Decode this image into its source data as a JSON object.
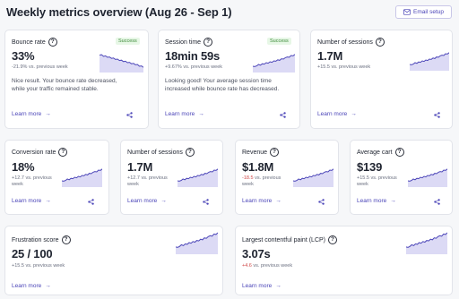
{
  "page": {
    "title": "Weekly metrics overview (Aug 26 - Sep 1)"
  },
  "actions": {
    "email_setup": "Email setup"
  },
  "common": {
    "learn_more": "Learn more",
    "help": "?",
    "arrow": "→"
  },
  "colors": {
    "accent": "#4b45b8",
    "spark_line": "#4b45b8",
    "spark_fill": "#dcdaf5",
    "success_bg": "#e7f7e6",
    "success_text": "#3d8b3a",
    "negative": "#d04a4a"
  },
  "cards": [
    {
      "title": "Bounce rate",
      "value": "33%",
      "badge": "Success",
      "delta": "-21.9%",
      "delta_suffix": " vs. previous week",
      "delta_color": "neutral",
      "description": [
        "Nice result. Your bounce rate decreased,",
        "while your traffic remained stable."
      ],
      "trend": "down"
    },
    {
      "title": "Session time",
      "value": "18min 59s",
      "badge": "Success",
      "delta": "+9.67%",
      "delta_suffix": " vs. previous week",
      "delta_color": "neutral",
      "description": [
        "Looking good! Your average session time",
        "increased while bounce rate has decreased."
      ],
      "trend": "up"
    },
    {
      "title": "Number of sessions",
      "value": "1.7M",
      "delta": "+15.5",
      "delta_suffix": " vs. previous week",
      "delta_color": "neutral",
      "trend": "up"
    },
    {
      "title": "Conversion rate",
      "value": "18%",
      "delta": "+12.7",
      "delta_suffix": " vs. previous",
      "delta_suffix2": "week",
      "delta_color": "neutral",
      "trend": "up"
    },
    {
      "title": "Number of sessions",
      "value": "1.7M",
      "delta": "+12.7",
      "delta_suffix": " vs. previous",
      "delta_suffix2": "week",
      "delta_color": "neutral",
      "trend": "up"
    },
    {
      "title": "Revenue",
      "value": "$1.8M",
      "delta": "-18.5",
      "delta_suffix": " vs. previous",
      "delta_suffix2": "week",
      "delta_color": "red",
      "trend": "up"
    },
    {
      "title": "Average cart",
      "value": "$139",
      "delta": "+15.5",
      "delta_suffix": " vs. previous",
      "delta_suffix2": "week",
      "delta_color": "neutral",
      "trend": "up"
    },
    {
      "title": "Frustration score",
      "value": "25 / 100",
      "delta": "+15.5",
      "delta_suffix": " vs. previous week",
      "delta_color": "neutral",
      "trend": "up"
    },
    {
      "title": "Largest contentful paint (LCP)",
      "value": "3.07s",
      "delta": "+4.6",
      "delta_suffix": " vs. previous week",
      "delta_color": "red",
      "trend": "up"
    }
  ]
}
